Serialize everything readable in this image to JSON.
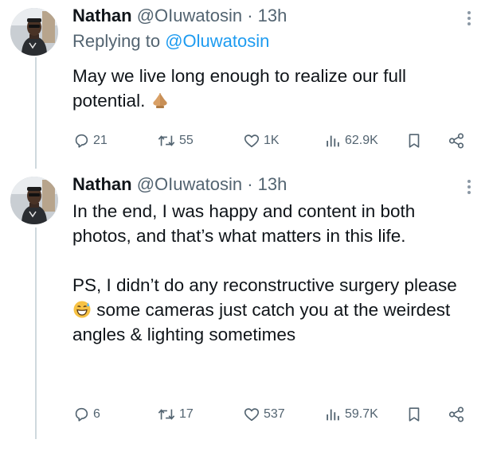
{
  "colors": {
    "text": "#0f1419",
    "secondary": "#536471",
    "link": "#1d9bf0",
    "thread_line": "#cfd9de"
  },
  "tweets": [
    {
      "name": "Nathan",
      "handle": "@OIuwatosin",
      "separator": "·",
      "time": "13h",
      "reply_label": "Replying to",
      "reply_mention": "@Oluwatosin",
      "text_lines": [
        "May we live long enough to realize our full potential."
      ],
      "emoji": "folded-hands",
      "replies": "21",
      "reposts": "55",
      "likes": "1K",
      "views": "62.9K"
    },
    {
      "name": "Nathan",
      "handle": "@OIuwatosin",
      "separator": "·",
      "time": "13h",
      "para1": "In the end, I was happy and content in both photos, and that’s what matters in this life.",
      "para2_a": "PS, I didn’t do any reconstructive surgery please",
      "emoji": "grinning-sweat",
      "para2_b": "some cameras just catch you at the weirdest angles & lighting sometimes",
      "replies": "6",
      "reposts": "17",
      "likes": "537",
      "views": "59.7K"
    }
  ]
}
